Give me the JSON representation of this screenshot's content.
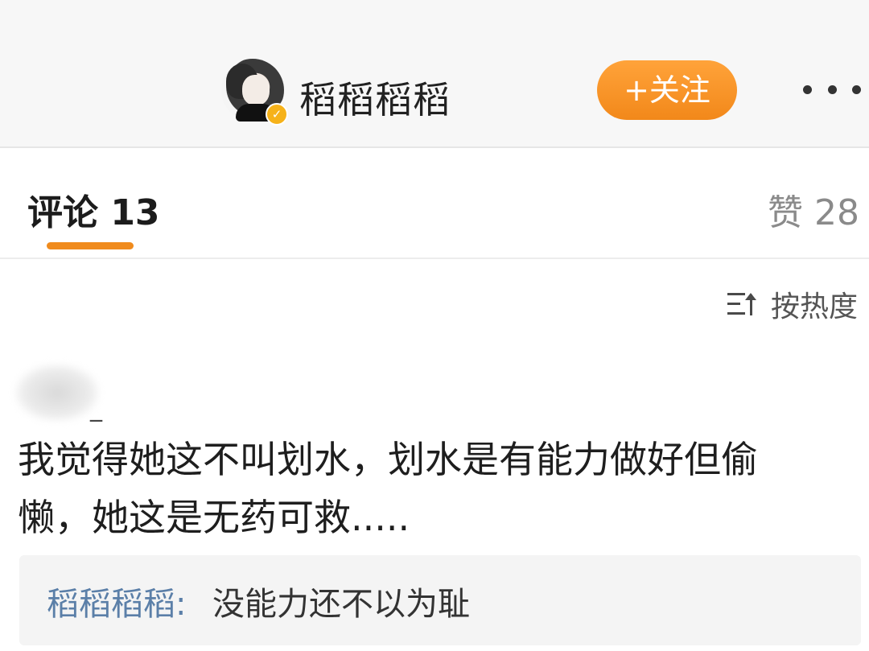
{
  "header": {
    "username": "稻稻稻稻",
    "follow_label": "+关注",
    "verified_mark": "✓",
    "more_icon": "more-horizontal-icon"
  },
  "tabs": {
    "comments_label": "评论 13",
    "likes_label": "赞 28"
  },
  "sort": {
    "label": "按热度",
    "icon": "sort-icon"
  },
  "comment": {
    "author": "_",
    "text": "我觉得她这不叫划水，划水是有能力做好但偷懒，她这是无药可救.....",
    "reply": {
      "author": "稻稻稻稻:",
      "text": "没能力还不以为耻"
    }
  },
  "colors": {
    "accent": "#f08b1d",
    "reply_author": "#5b7fa8",
    "verified": "#f6b21a"
  }
}
